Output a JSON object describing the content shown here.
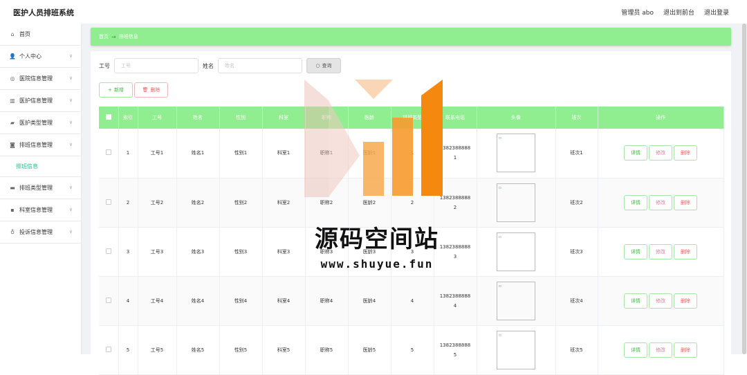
{
  "app": {
    "title": "医护人员排班系统"
  },
  "topbar": {
    "links": [
      "管理员 abo",
      "退出到前台",
      "退出登录"
    ]
  },
  "sidebar": {
    "items": [
      {
        "label": "首页",
        "icon": "home-icon",
        "glyph": "⌂",
        "expandable": false
      },
      {
        "label": "个人中心",
        "icon": "user-icon",
        "glyph": "👤",
        "expandable": true
      },
      {
        "label": "医院信息管理",
        "icon": "compass-icon",
        "glyph": "◎",
        "expandable": true
      },
      {
        "label": "医护信息管理",
        "icon": "bar-chart-icon",
        "glyph": "▥",
        "expandable": true
      },
      {
        "label": "医护类型管理",
        "icon": "thumb-icon",
        "glyph": "▰",
        "expandable": true
      },
      {
        "label": "排班信息管理",
        "icon": "mic-icon",
        "glyph": "◙",
        "expandable": true
      }
    ],
    "active_sub": "排班信息",
    "items_after": [
      {
        "label": "排班类型管理",
        "icon": "monitor-icon",
        "glyph": "▬",
        "expandable": true
      },
      {
        "label": "科室信息管理",
        "icon": "chat-icon",
        "glyph": "▪",
        "expandable": true
      },
      {
        "label": "投诉信息管理",
        "icon": "microphone-icon",
        "glyph": "♁",
        "expandable": true
      }
    ]
  },
  "breadcrumb": {
    "home": "首页",
    "current": "排班信息"
  },
  "search": {
    "field1_label": "工号",
    "field1_placeholder": "工号",
    "field2_label": "姓名",
    "field2_placeholder": "姓名",
    "query_label": "查询"
  },
  "actions": {
    "add_label": "新增",
    "delete_label": "删除"
  },
  "table": {
    "columns": [
      "",
      "索引",
      "工号",
      "姓名",
      "性别",
      "科室",
      "职称",
      "医龄",
      "排班类型",
      "联系电话",
      "头像",
      "班次",
      "操作"
    ],
    "rows": [
      {
        "index": "1",
        "gonghao": "工号1",
        "name": "姓名1",
        "gender": "性别1",
        "dept": "科室1",
        "title": "职称1",
        "age": "医龄1",
        "type": "1",
        "phone": "13823888881",
        "shift": "班次1"
      },
      {
        "index": "2",
        "gonghao": "工号2",
        "name": "姓名2",
        "gender": "性别2",
        "dept": "科室2",
        "title": "职称2",
        "age": "医龄2",
        "type": "2",
        "phone": "13823888882",
        "shift": "班次2"
      },
      {
        "index": "3",
        "gonghao": "工号3",
        "name": "姓名3",
        "gender": "性别3",
        "dept": "科室3",
        "title": "职称3",
        "age": "医龄3",
        "type": "3",
        "phone": "13823888883",
        "shift": "班次3"
      },
      {
        "index": "4",
        "gonghao": "工号4",
        "name": "姓名4",
        "gender": "性别4",
        "dept": "科室4",
        "title": "职称4",
        "age": "医龄4",
        "type": "4",
        "phone": "13823888884",
        "shift": "班次4"
      },
      {
        "index": "5",
        "gonghao": "工号5",
        "name": "姓名5",
        "gender": "性别5",
        "dept": "科室5",
        "title": "职称5",
        "age": "医龄5",
        "type": "5",
        "phone": "13823888885",
        "shift": "班次5"
      }
    ],
    "ops": {
      "detail": "详情",
      "edit": "修改",
      "delete": "删除"
    }
  },
  "watermark": {
    "text": "源码空间站",
    "url": "www.shuyue.fun"
  },
  "colors": {
    "accent": "#90ee90",
    "active_menu": "#1ec28b",
    "danger": "#ee5a5a",
    "wm_orange": "#f5890f"
  }
}
